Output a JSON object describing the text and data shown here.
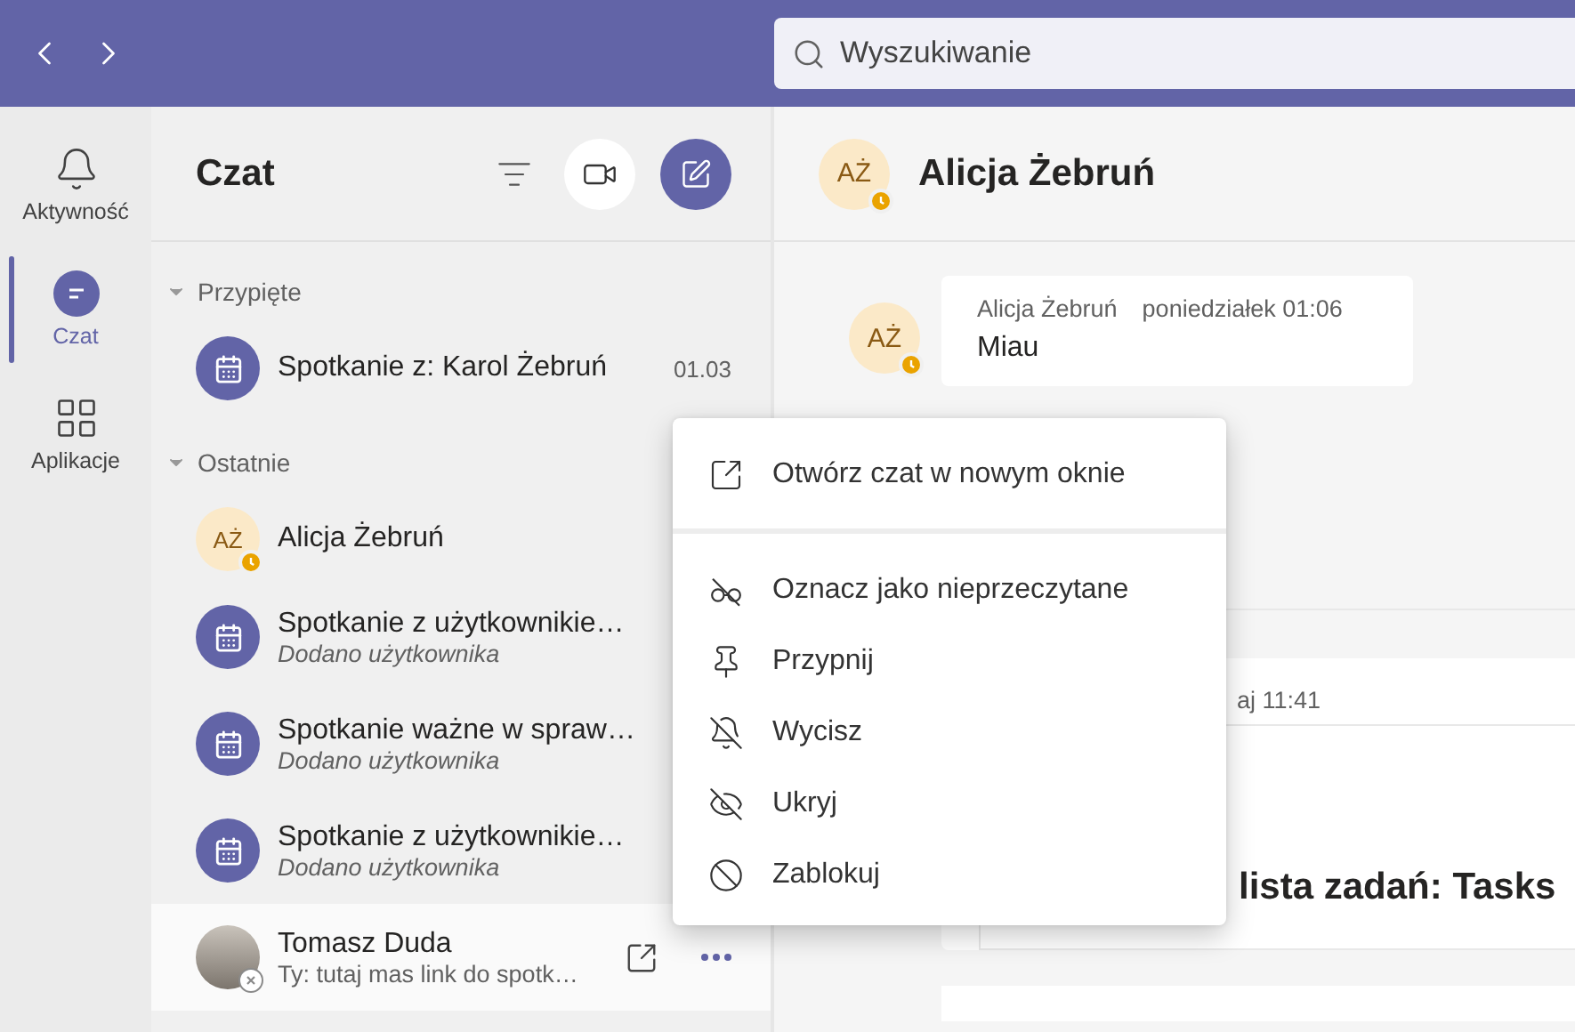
{
  "search": {
    "placeholder": "Wyszukiwanie"
  },
  "rail": [
    {
      "label": "Aktywność",
      "selected": false
    },
    {
      "label": "Czat",
      "selected": true
    },
    {
      "label": "Aplikacje",
      "selected": false
    }
  ],
  "chat_list": {
    "title": "Czat",
    "sections": [
      {
        "title": "Przypięte",
        "expanded": true,
        "items": [
          {
            "kind": "meeting",
            "name": "Spotkanie z: Karol Żebruń",
            "time": "01.03",
            "hovered": false
          }
        ]
      },
      {
        "title": "Ostatnie",
        "expanded": true,
        "items": [
          {
            "kind": "person",
            "initials": "AŻ",
            "away": true,
            "name": "Alicja Żebruń",
            "hovered": false
          },
          {
            "kind": "meeting",
            "name": "Spotkanie z użytkownikie…",
            "preview": "Dodano użytkownika",
            "hovered": false
          },
          {
            "kind": "meeting",
            "name": "Spotkanie ważne w spraw…",
            "preview": "Dodano użytkownika",
            "hovered": false
          },
          {
            "kind": "meeting",
            "name": "Spotkanie z użytkownikie…",
            "preview": "Dodano użytkownika",
            "hovered": false
          },
          {
            "kind": "photo",
            "offline": true,
            "name": "Tomasz Duda",
            "preview": "Ty: tutaj mas link do spotk…",
            "hovered": true
          }
        ]
      }
    ]
  },
  "conversation": {
    "initials": "AŻ",
    "away": true,
    "title": "Alicja Żebruń",
    "messages": [
      {
        "initials": "AŻ",
        "away": true,
        "author": "Alicja Żebruń",
        "time": "poniedziałek 01:06",
        "text": "Miau"
      }
    ],
    "covered_card": {
      "time": "aj 11:41",
      "title": "lista zadań: Tasks"
    }
  },
  "context_menu": {
    "groups": [
      {
        "items": [
          {
            "label": "Otwórz czat w nowym oknie"
          }
        ]
      },
      {
        "items": [
          {
            "label": "Oznacz jako nieprzeczytane"
          },
          {
            "label": "Przypnij"
          },
          {
            "label": "Wycisz"
          },
          {
            "label": "Ukryj"
          },
          {
            "label": "Zablokuj"
          }
        ]
      }
    ]
  }
}
